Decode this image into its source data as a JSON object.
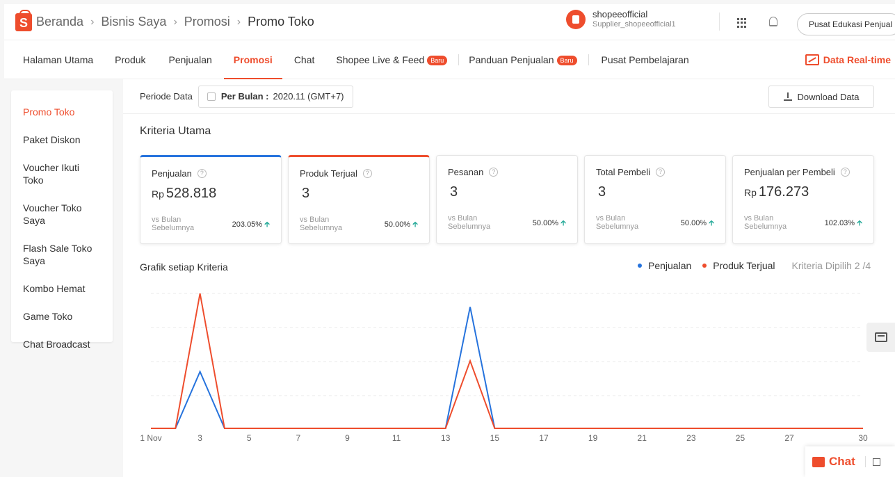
{
  "header": {
    "logo_letter": "S",
    "breadcrumb": [
      "Beranda",
      "Bisnis Saya",
      "Promosi",
      "Promo Toko"
    ],
    "breadcrumb_sep": "›",
    "shop_name": "shopeeofficial",
    "shop_sub": "Supplier_shopeeofficial1",
    "edu_button": "Pusat Edukasi Penjual"
  },
  "nav": {
    "tabs": [
      "Halaman Utama",
      "Produk",
      "Penjualan",
      "Promosi",
      "Chat",
      "Shopee Live & Feed",
      "Panduan Penjualan",
      "Pusat Pembelajaran"
    ],
    "active_tab": "Promosi",
    "badge": "Baru",
    "realtime": "Data Real-time"
  },
  "sidebar": {
    "items": [
      "Promo Toko",
      "Paket Diskon",
      "Voucher Ikuti Toko",
      "Voucher Toko Saya",
      "Flash Sale Toko Saya",
      "Kombo Hemat",
      "Game Toko",
      "Chat Broadcast"
    ],
    "active": "Promo Toko"
  },
  "period": {
    "label": "Periode Data",
    "type": "Per Bulan :",
    "value": "2020.11 (GMT+7)",
    "download": "Download Data"
  },
  "section_title": "Kriteria Utama",
  "cards": [
    {
      "title": "Penjualan",
      "currency": "Rp",
      "value": "528.818",
      "vs": "vs Bulan Sebelumnya",
      "change": "203.05%"
    },
    {
      "title": "Produk Terjual",
      "currency": "",
      "value": "3",
      "vs": "vs Bulan Sebelumnya",
      "change": "50.00%"
    },
    {
      "title": "Pesanan",
      "currency": "",
      "value": "3",
      "vs": "vs Bulan Sebelumnya",
      "change": "50.00%"
    },
    {
      "title": "Total Pembeli",
      "currency": "",
      "value": "3",
      "vs": "vs Bulan Sebelumnya",
      "change": "50.00%"
    },
    {
      "title": "Penjualan per Pembeli",
      "currency": "Rp",
      "value": "176.273",
      "vs": "vs Bulan Sebelumnya",
      "change": "102.03%"
    }
  ],
  "chart_section": {
    "title": "Grafik setiap Kriteria",
    "legend": [
      "Penjualan",
      "Produk Terjual"
    ],
    "criteria": "Kriteria Dipilih 2 /4"
  },
  "colors": {
    "accent": "#ee4d2d",
    "blue": "#2673dd",
    "up": "#26aa99"
  },
  "chart_data": {
    "type": "line",
    "x": [
      "1 Nov",
      "2",
      "3",
      "4",
      "5",
      "6",
      "7",
      "8",
      "9",
      "10",
      "11",
      "12",
      "13",
      "14",
      "15",
      "16",
      "17",
      "18",
      "19",
      "20",
      "21",
      "22",
      "23",
      "24",
      "25",
      "26",
      "27",
      "28",
      "29",
      "30"
    ],
    "tick_labels": [
      "1 Nov",
      "3",
      "5",
      "7",
      "9",
      "11",
      "13",
      "15",
      "17",
      "19",
      "21",
      "23",
      "25",
      "27",
      "30"
    ],
    "series": [
      {
        "name": "Penjualan",
        "color": "#2673dd",
        "values": [
          0,
          0,
          0.42,
          0,
          0,
          0,
          0,
          0,
          0,
          0,
          0,
          0,
          0,
          0.9,
          0,
          0,
          0,
          0,
          0,
          0,
          0,
          0,
          0,
          0,
          0,
          0,
          0,
          0,
          0,
          0
        ]
      },
      {
        "name": "Produk Terjual",
        "color": "#ee4d2d",
        "values": [
          0,
          0,
          1,
          0,
          0,
          0,
          0,
          0,
          0,
          0,
          0,
          0,
          0,
          0.5,
          0,
          0,
          0,
          0,
          0,
          0,
          0,
          0,
          0,
          0,
          0,
          0,
          0,
          0,
          0,
          0
        ]
      }
    ],
    "ylim": [
      0,
      1
    ],
    "grid": true
  },
  "floating": {
    "chat": "Chat"
  }
}
